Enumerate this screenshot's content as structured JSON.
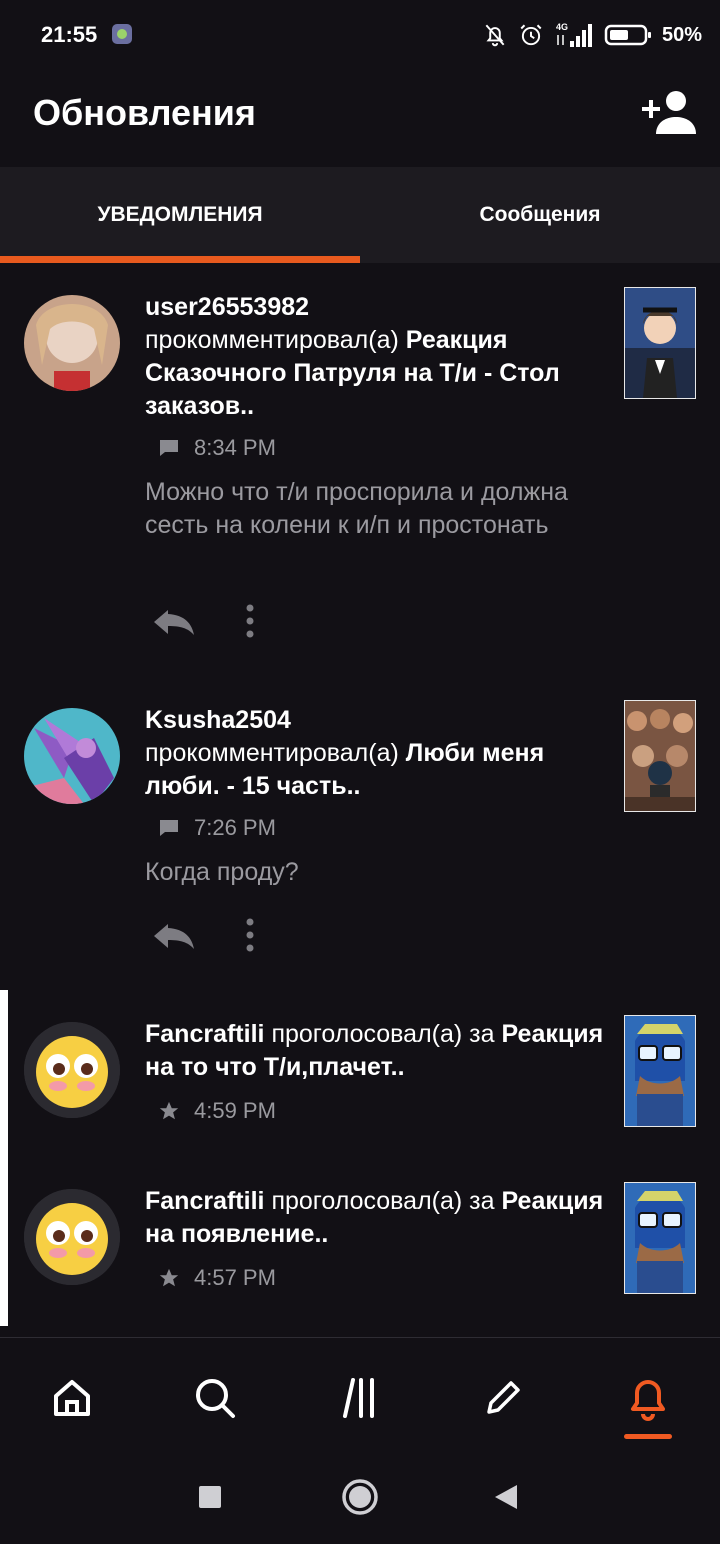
{
  "status_bar": {
    "time": "21:55",
    "network": "4G",
    "battery": "50%",
    "icons": [
      "app-notification-icon",
      "bell-muted-icon",
      "alarm-icon",
      "signal-4g-icon",
      "battery-icon"
    ]
  },
  "header": {
    "title": "Обновления",
    "action_icon": "add-user-icon"
  },
  "tabs": [
    {
      "label": "УВЕДОМЛЕНИЯ",
      "active": true
    },
    {
      "label": "Сообщения",
      "active": false
    }
  ],
  "colors": {
    "background": "#121015",
    "tab_background": "#1d1b20",
    "accent": "#e85a1e",
    "muted_text": "#9b9aa0"
  },
  "notifications": [
    {
      "user": "user26553982",
      "action": "прокомментировал(а)",
      "story": "Реакция Сказочного Патруля на Т/и - Стол заказов..",
      "time": "8:34 PM",
      "type_icon": "comment-icon",
      "comment": "Можно что т/и проспорила и должна  сесть на колени к и/п и простонать",
      "actions": [
        "reply-icon",
        "more-icon"
      ]
    },
    {
      "user": "Ksusha2504",
      "action": "прокомментировал(а)",
      "story": "Люби меня люби. - 15 часть..",
      "time": "7:26 PM",
      "type_icon": "comment-icon",
      "comment": "Когда проду?",
      "actions": [
        "reply-icon",
        "more-icon"
      ]
    },
    {
      "user": "Fancraftili",
      "action": "проголосовал(а) за",
      "story": "Реакция на то что Т/и,плачет..",
      "time": "4:59 PM",
      "type_icon": "star-icon",
      "unread": true
    },
    {
      "user": "Fancraftili",
      "action": "проголосовал(а) за",
      "story": "Реакция на появление..",
      "time": "4:57 PM",
      "type_icon": "star-icon",
      "unread": true
    }
  ],
  "bottom_nav": [
    {
      "icon": "home-icon",
      "active": false
    },
    {
      "icon": "search-icon",
      "active": false
    },
    {
      "icon": "library-icon",
      "active": false
    },
    {
      "icon": "write-icon",
      "active": false
    },
    {
      "icon": "bell-icon",
      "active": true
    }
  ],
  "system_nav": [
    "recents-icon",
    "home-circle-icon",
    "back-icon"
  ]
}
